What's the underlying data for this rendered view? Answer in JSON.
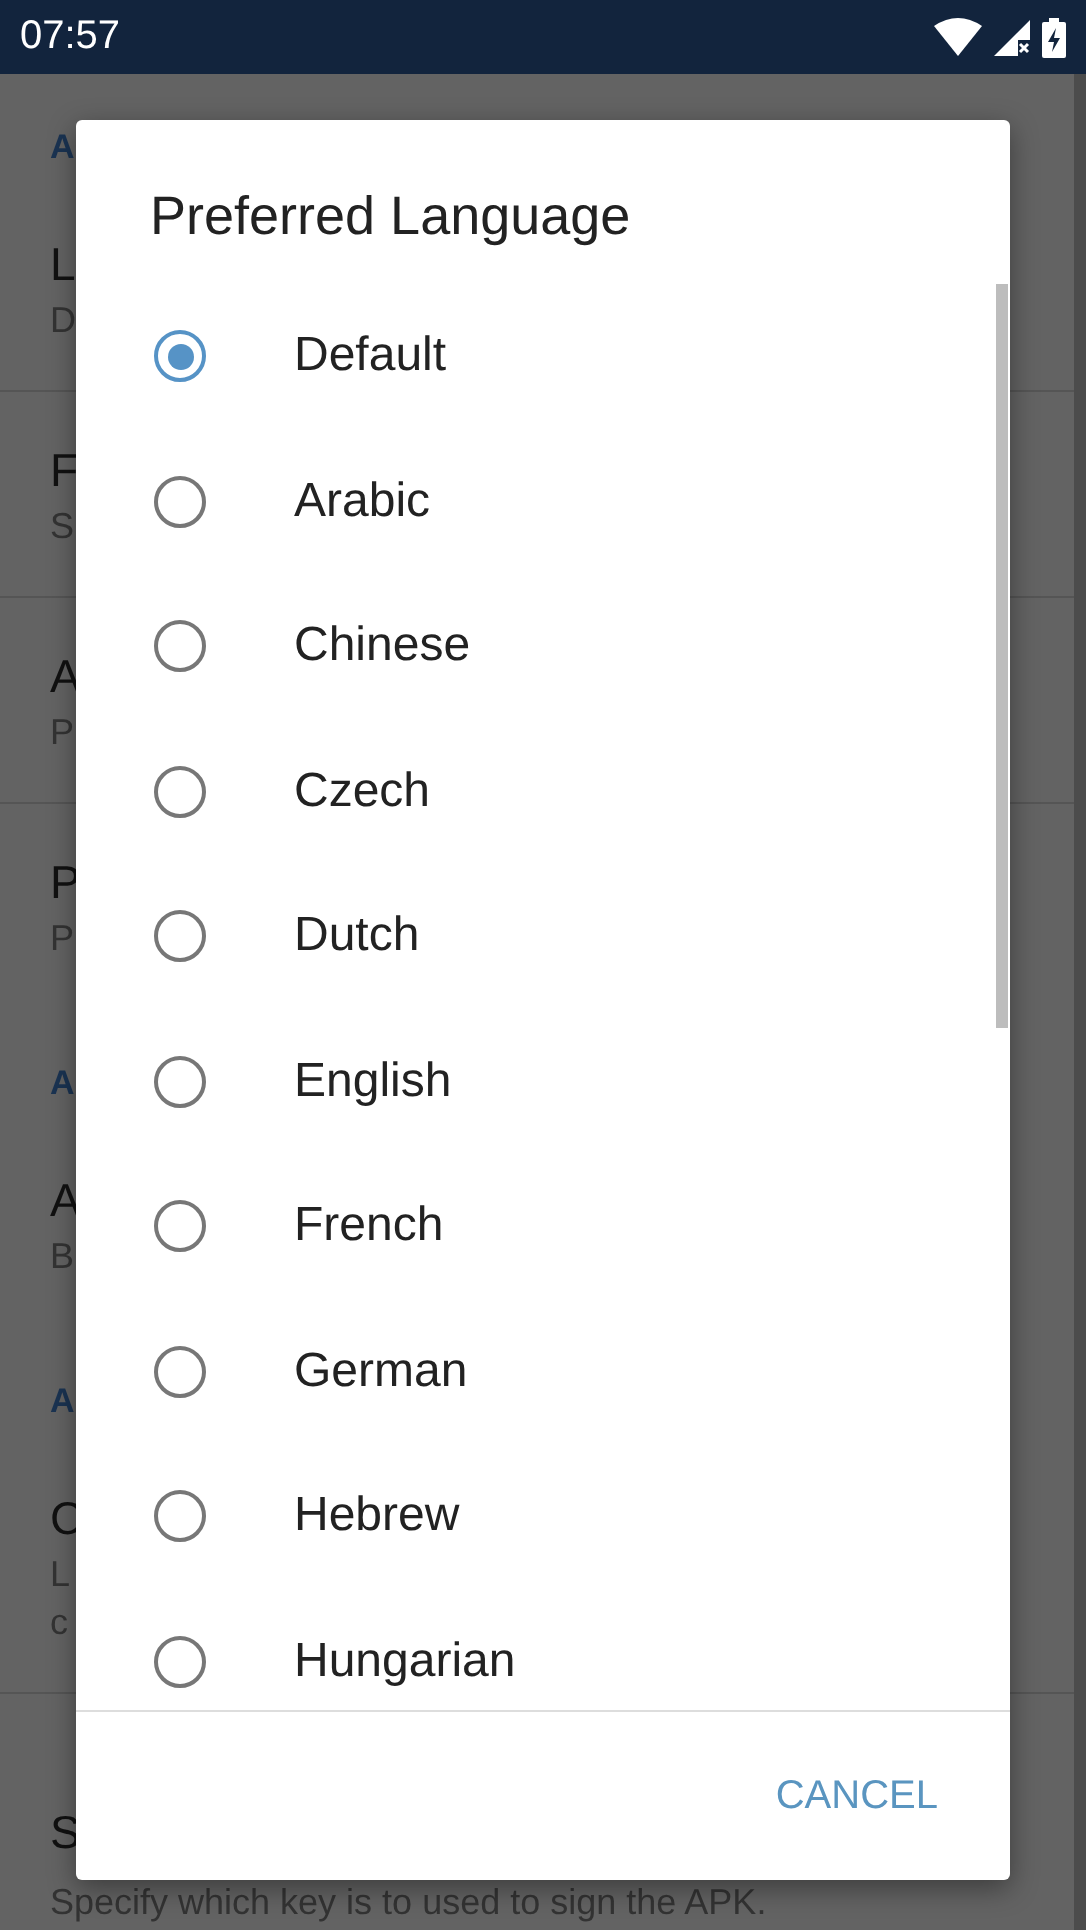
{
  "status_bar": {
    "time": "07:57"
  },
  "settings": [
    {
      "kind": "category",
      "title": "A"
    },
    {
      "kind": "setting",
      "title": "L",
      "summary": [
        "D"
      ],
      "divider": true
    },
    {
      "kind": "setting",
      "title": "F",
      "summary": [
        "S"
      ],
      "divider": true
    },
    {
      "kind": "setting",
      "title": "A",
      "summary": [
        "P"
      ],
      "divider": true
    },
    {
      "kind": "setting",
      "title": "P",
      "summary": [
        "P"
      ],
      "divider": false
    },
    {
      "kind": "category",
      "title": "A"
    },
    {
      "kind": "setting",
      "title": "A",
      "summary": [
        "B"
      ],
      "divider": false
    },
    {
      "kind": "category",
      "title": "A"
    },
    {
      "kind": "setting",
      "title": "C",
      "summary": [
        "L",
        "c"
      ],
      "divider": true
    },
    {
      "kind": "setting",
      "title": "S",
      "summary": [
        "Specify which key is to used to sign the APK."
      ]
    }
  ],
  "dialog": {
    "title": "Preferred Language",
    "options": [
      {
        "label": "Default",
        "selected": true
      },
      {
        "label": "Arabic",
        "selected": false
      },
      {
        "label": "Chinese",
        "selected": false
      },
      {
        "label": "Czech",
        "selected": false
      },
      {
        "label": "Dutch",
        "selected": false
      },
      {
        "label": "English",
        "selected": false
      },
      {
        "label": "French",
        "selected": false
      },
      {
        "label": "German",
        "selected": false
      },
      {
        "label": "Hebrew",
        "selected": false
      },
      {
        "label": "Hungarian",
        "selected": false
      }
    ],
    "buttons": [
      "CANCEL"
    ]
  }
}
